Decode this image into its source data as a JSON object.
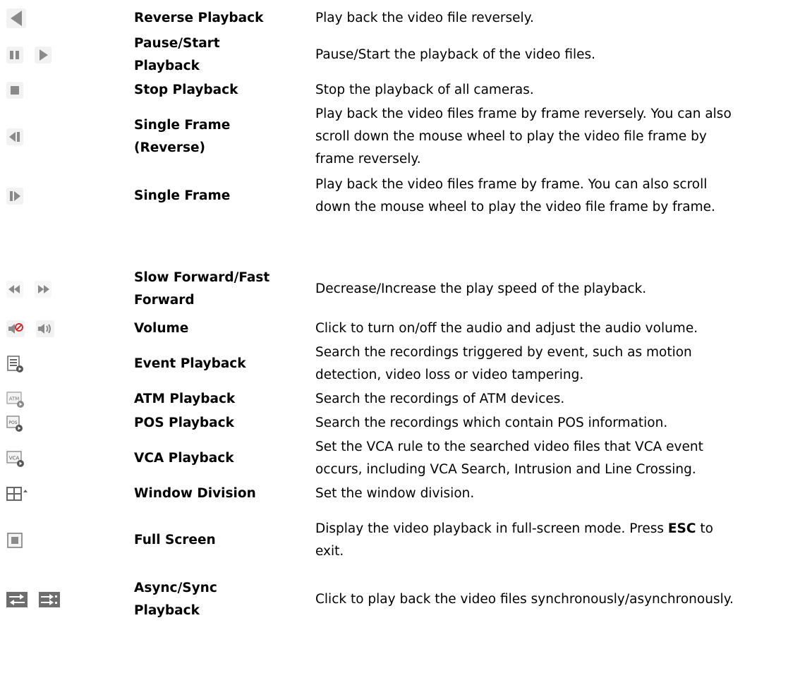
{
  "rows": [
    {
      "name": "Reverse Playback",
      "desc": "Play back the video file reversely.",
      "icons": [
        "reverse-play-icon"
      ]
    },
    {
      "name_lines": [
        "Pause/Start",
        "Playback"
      ],
      "desc": "Pause/Start the playback of the video files.",
      "icons": [
        "pause-icon",
        "play-icon"
      ]
    },
    {
      "name": "Stop Playback",
      "desc": "Stop the playback of all cameras.",
      "icons": [
        "stop-icon"
      ]
    },
    {
      "name_lines": [
        "Single Frame",
        "(Reverse)"
      ],
      "desc_lines": [
        "Play back the video files frame by frame reversely. You can also",
        "scroll down the mouse wheel to play the video file frame by",
        "frame reversely."
      ],
      "icons": [
        "single-frame-reverse-icon"
      ]
    },
    {
      "name": "Single Frame",
      "desc_lines": [
        "Play back the video files frame by frame. You can also scroll",
        "down the mouse wheel to play the video file frame by frame."
      ],
      "icons": [
        "single-frame-icon"
      ]
    },
    {
      "name_lines": [
        "Slow Forward/Fast",
        "Forward"
      ],
      "desc": "Decrease/Increase the play speed of the playback.",
      "icons": [
        "slow-forward-icon",
        "fast-forward-icon"
      ]
    },
    {
      "name": "Volume",
      "desc": "Click to turn on/off the audio and adjust the audio volume.",
      "icons": [
        "volume-off-icon",
        "volume-on-icon"
      ]
    },
    {
      "name": "Event Playback",
      "desc_lines": [
        "Search the recordings triggered by event, such as motion",
        "detection, video loss or video tampering."
      ],
      "icons": [
        "event-playback-icon"
      ]
    },
    {
      "name": "ATM Playback",
      "desc": "Search the recordings of ATM devices.",
      "icons": [
        "atm-playback-icon"
      ],
      "icon_text": "ATM"
    },
    {
      "name": "POS Playback",
      "desc": "Search the recordings which contain POS information.",
      "icons": [
        "pos-playback-icon"
      ],
      "icon_text": "POS"
    },
    {
      "name": "VCA Playback",
      "desc_lines": [
        "Set the VCA rule to the searched video files that VCA event",
        "occurs, including VCA Search, Intrusion and Line Crossing."
      ],
      "icons": [
        "vca-playback-icon"
      ],
      "icon_text": "VCA"
    },
    {
      "name": "Window Division",
      "desc": "Set the window division.",
      "icons": [
        "window-division-icon"
      ]
    },
    {
      "name": "Full Screen",
      "desc_lines": [
        "Display the video playback in full-screen mode. Press",
        "ESC",
        "to",
        "exit."
      ],
      "icons": [
        "full-screen-icon"
      ]
    },
    {
      "name_lines": [
        "Async/Sync",
        "Playback"
      ],
      "desc": "Click to play back the video files synchronously/asynchronously.",
      "icons": [
        "async-icon",
        "sync-icon"
      ]
    }
  ],
  "colors": {
    "icon_gray": "#8a8a8a",
    "icon_light": "#d8d8d8",
    "icon_dark": "#555555",
    "red": "#d03030",
    "sync_bg": "#6d6d6d"
  }
}
